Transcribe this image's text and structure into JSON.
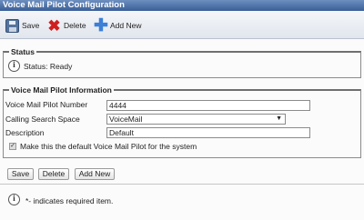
{
  "window": {
    "title": "Voice Mail Pilot Configuration"
  },
  "toolbar": {
    "save_label": "Save",
    "delete_label": "Delete",
    "add_new_label": "Add New"
  },
  "status": {
    "legend": "Status",
    "text": "Status: Ready"
  },
  "info": {
    "legend": "Voice Mail Pilot Information",
    "fields": {
      "pilot_number": {
        "label": "Voice Mail Pilot Number",
        "value": "4444"
      },
      "css": {
        "label": "Calling Search Space",
        "value": "VoiceMail"
      },
      "description": {
        "label": "Description",
        "value": "Default"
      }
    },
    "default_checkbox": {
      "label": "Make this the default Voice Mail Pilot for the system",
      "checked": true
    }
  },
  "buttons": {
    "save": "Save",
    "delete": "Delete",
    "add_new": "Add New"
  },
  "footer": {
    "required_note": "*- indicates required item."
  },
  "icons": {
    "save": "save-disk-icon",
    "delete": "delete-x-icon",
    "add_new": "add-plus-icon",
    "info": "info-icon",
    "dropdown": "chevron-down-icon"
  },
  "colors": {
    "titlebar": "#3a5f97",
    "delete_icon": "#d01f1f",
    "add_icon": "#3c7fd6"
  }
}
